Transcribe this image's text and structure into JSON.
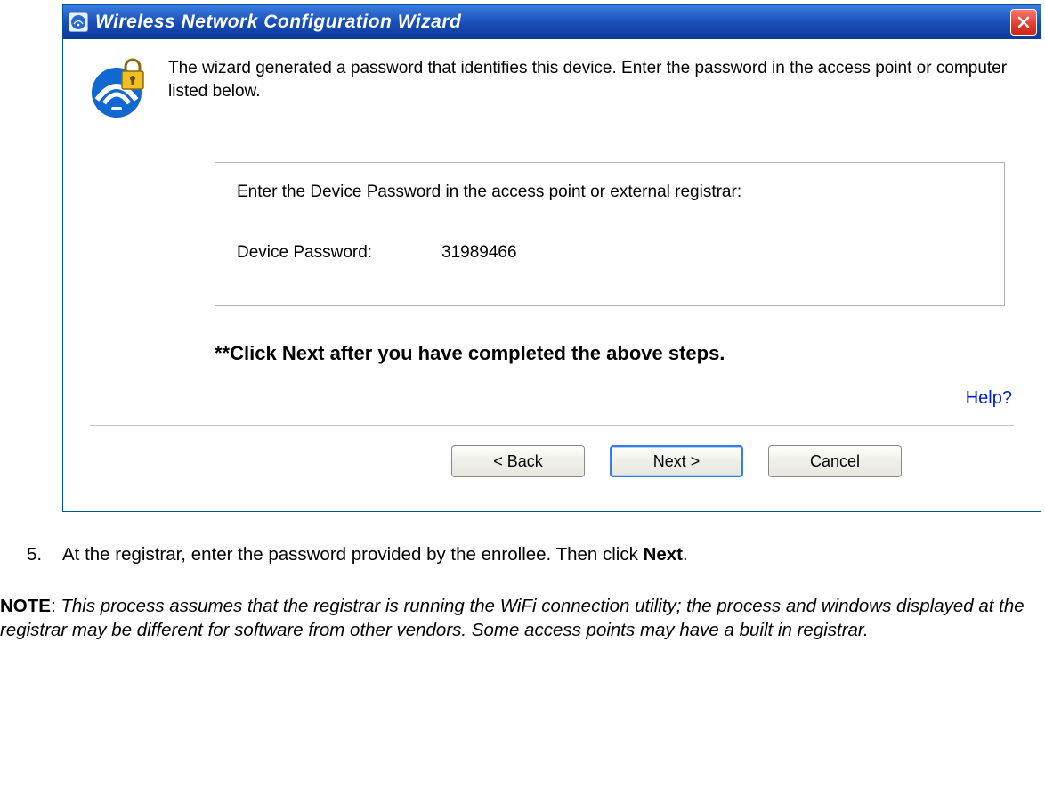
{
  "dialog": {
    "title": "Wireless Network Configuration Wizard",
    "intro": "The wizard generated a password that identifies this device. Enter the password in the access point or computer listed below.",
    "frame_instruction": "Enter the Device Password in the access point or external registrar:",
    "pw_label": "Device Password:",
    "pw_value": "31989466",
    "click_next": "**Click Next after you have completed the above steps.",
    "help": "Help?",
    "buttons": {
      "back": "Back",
      "next": "Next",
      "cancel": "Cancel"
    }
  },
  "doc": {
    "step_num": "5.",
    "step_text_a": "At the registrar, enter the password provided by the enrollee. Then click ",
    "step_text_b": "Next",
    "step_text_c": ".",
    "note_label": "NOTE",
    "note_sep": ": ",
    "note_body": "This process assumes that the registrar is running the WiFi connection utility; the process and windows displayed at the registrar may be different for software from other vendors. Some access points may have a built in registrar."
  }
}
